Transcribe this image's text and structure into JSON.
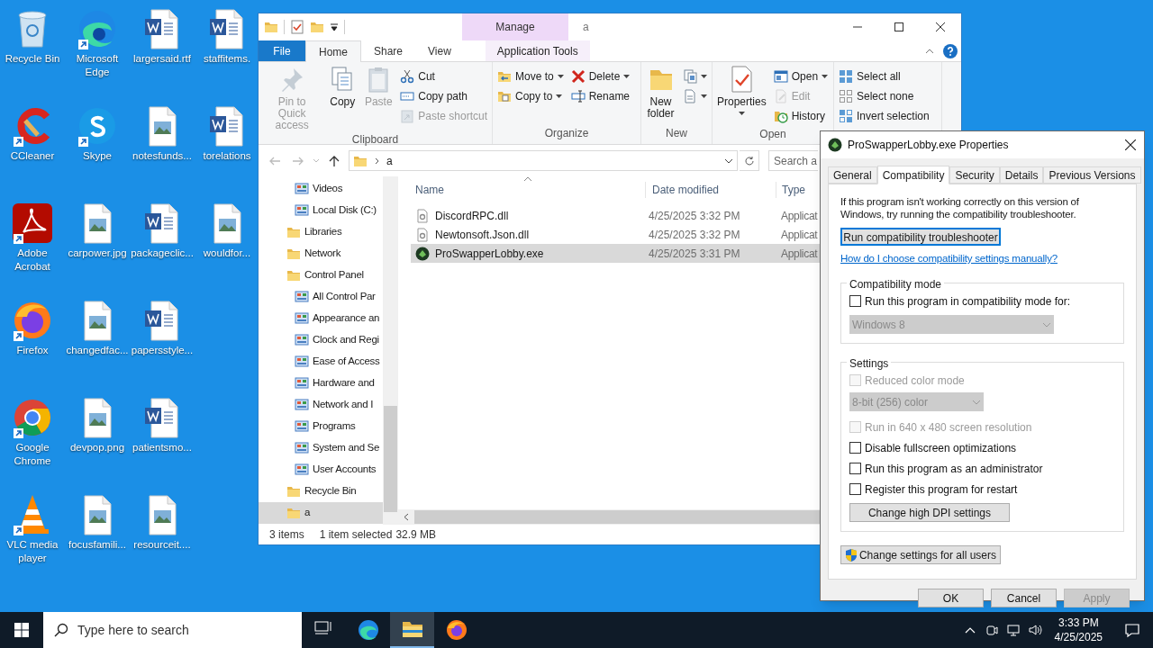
{
  "desktop": {
    "icons": [
      {
        "label": "Recycle Bin",
        "kind": "recycle",
        "shortcut": false
      },
      {
        "label": "CCleaner",
        "kind": "ccleaner",
        "shortcut": true
      },
      {
        "label": "Adobe Acrobat",
        "kind": "acrobat",
        "shortcut": true
      },
      {
        "label": "Firefox",
        "kind": "firefox",
        "shortcut": true
      },
      {
        "label": "Google Chrome",
        "kind": "chrome",
        "shortcut": true
      },
      {
        "label": "VLC media player",
        "kind": "vlc",
        "shortcut": true
      },
      {
        "label": "Microsoft Edge",
        "kind": "edge",
        "shortcut": true
      },
      {
        "label": "Skype",
        "kind": "skype",
        "shortcut": true
      },
      {
        "label": "carpower.jpg",
        "kind": "image",
        "shortcut": false
      },
      {
        "label": "changedfac...",
        "kind": "image",
        "shortcut": false
      },
      {
        "label": "devpop.png",
        "kind": "image",
        "shortcut": false
      },
      {
        "label": "focusfamili...",
        "kind": "image",
        "shortcut": false
      },
      {
        "label": "largersaid.rtf",
        "kind": "word",
        "shortcut": false
      },
      {
        "label": "notesfunds...",
        "kind": "image",
        "shortcut": false
      },
      {
        "label": "packageclic...",
        "kind": "word",
        "shortcut": false
      },
      {
        "label": "papersstyle...",
        "kind": "word",
        "shortcut": false
      },
      {
        "label": "patientsmo...",
        "kind": "word",
        "shortcut": false
      },
      {
        "label": "resourceit....",
        "kind": "image",
        "shortcut": false
      },
      {
        "label": "staffitems.",
        "kind": "word",
        "shortcut": false
      },
      {
        "label": "torelations",
        "kind": "word",
        "shortcut": false
      },
      {
        "label": "wouldfor...",
        "kind": "image",
        "shortcut": false
      }
    ]
  },
  "explorer": {
    "title": "a",
    "context_tab": "Manage",
    "tabs": [
      {
        "label": "File",
        "kind": "file",
        "selected": false
      },
      {
        "label": "Home",
        "kind": "tab",
        "selected": true
      },
      {
        "label": "Share",
        "kind": "tab",
        "selected": false
      },
      {
        "label": "View",
        "kind": "tab",
        "selected": false
      },
      {
        "label": "Application Tools",
        "kind": "context",
        "selected": false
      }
    ],
    "ribbon": [
      {
        "label": "Clipboard",
        "columns": [
          [
            {
              "label": "Pin to Quick access",
              "kind": "large",
              "disabled": true,
              "dropdown": false
            }
          ],
          [
            {
              "label": "Copy",
              "kind": "large",
              "disabled": false,
              "dropdown": false
            }
          ],
          [
            {
              "label": "Paste",
              "kind": "large",
              "disabled": true,
              "dropdown": false
            }
          ],
          [
            {
              "label": "Cut",
              "kind": "small",
              "disabled": false,
              "dropdown": false
            },
            {
              "label": "Copy path",
              "kind": "small",
              "disabled": false,
              "dropdown": false
            },
            {
              "label": "Paste shortcut",
              "kind": "small",
              "disabled": true,
              "dropdown": false
            }
          ]
        ]
      },
      {
        "label": "Organize",
        "columns": [
          [
            {
              "label": "Move to",
              "kind": "small",
              "disabled": false,
              "dropdown": true
            },
            {
              "label": "Copy to",
              "kind": "small",
              "disabled": false,
              "dropdown": true
            }
          ],
          [
            {
              "label": "Delete",
              "kind": "small",
              "disabled": false,
              "dropdown": true
            },
            {
              "label": "Rename",
              "kind": "small",
              "disabled": false,
              "dropdown": false
            }
          ]
        ]
      },
      {
        "label": "New",
        "columns": [
          [
            {
              "label": "New folder",
              "kind": "large",
              "disabled": false,
              "dropdown": false
            }
          ],
          [
            {
              "kind": "icon",
              "disabled": false,
              "dropdown": true
            },
            {
              "kind": "icon",
              "disabled": false,
              "dropdown": true
            }
          ]
        ]
      },
      {
        "label": "Open",
        "columns": [
          [
            {
              "label": "Properties",
              "kind": "large",
              "disabled": false,
              "dropdown": true
            }
          ],
          [
            {
              "label": "Open",
              "kind": "small",
              "disabled": false,
              "dropdown": true
            },
            {
              "label": "Edit",
              "kind": "small",
              "disabled": true,
              "dropdown": false
            },
            {
              "label": "History",
              "kind": "small",
              "disabled": false,
              "dropdown": false
            }
          ]
        ]
      },
      {
        "columns": [
          [
            {
              "label": "Select all",
              "kind": "small",
              "disabled": false,
              "dropdown": false
            },
            {
              "label": "Select none",
              "kind": "small",
              "disabled": false,
              "dropdown": false
            },
            {
              "label": "Invert selection",
              "kind": "small",
              "disabled": false,
              "dropdown": false
            }
          ]
        ]
      }
    ],
    "address": {
      "path": "a"
    },
    "search": {
      "placeholder": "Search a"
    },
    "nav": {
      "continued_items": [
        {
          "label": "Videos",
          "selected": false
        },
        {
          "label": "Local Disk (C:)",
          "selected": false
        }
      ],
      "items": [
        {
          "label": "Libraries",
          "selected": false
        },
        {
          "label": "Network",
          "selected": false
        },
        {
          "label": "Control Panel",
          "selected": false,
          "children": [
            {
              "label": "All Control Par",
              "selected": false
            },
            {
              "label": "Appearance an",
              "selected": false
            },
            {
              "label": "Clock and Regi",
              "selected": false
            },
            {
              "label": "Ease of Access",
              "selected": false
            },
            {
              "label": "Hardware and",
              "selected": false
            },
            {
              "label": "Network and I",
              "selected": false
            },
            {
              "label": "Programs",
              "selected": false
            },
            {
              "label": "System and Se",
              "selected": false
            },
            {
              "label": "User Accounts",
              "selected": false
            }
          ]
        },
        {
          "label": "Recycle Bin",
          "selected": false
        },
        {
          "label": "a",
          "selected": true
        }
      ]
    },
    "columns": [
      "Name",
      "Date modified",
      "Type"
    ],
    "files": [
      {
        "name": "DiscordRPC.dll",
        "date": "4/25/2025 3:32 PM",
        "type": "Applicat",
        "kind": "dll",
        "selected": false
      },
      {
        "name": "Newtonsoft.Json.dll",
        "date": "4/25/2025 3:32 PM",
        "type": "Applicat",
        "kind": "dll",
        "selected": false
      },
      {
        "name": "ProSwapperLobby.exe",
        "date": "4/25/2025 3:31 PM",
        "type": "Applicat",
        "kind": "exe",
        "selected": true
      }
    ],
    "status": {
      "count": "3 items",
      "selection": "1 item selected",
      "size": "32.9 MB"
    }
  },
  "dialog": {
    "title": "ProSwapperLobby.exe Properties",
    "tabs": [
      {
        "label": "General",
        "selected": false
      },
      {
        "label": "Compatibility",
        "selected": true
      },
      {
        "label": "Security",
        "selected": false
      },
      {
        "label": "Details",
        "selected": false
      },
      {
        "label": "Previous Versions",
        "selected": false
      }
    ],
    "intro": "If this program isn't working correctly on this version of Windows, try running the compatibility troubleshooter.",
    "troubleshooter_button": "Run compatibility troubleshooter",
    "help_link": "How do I choose compatibility settings manually?",
    "compatibility_mode": {
      "legend": "Compatibility mode",
      "option": {
        "label": "Run this program in compatibility mode for:",
        "checked": false,
        "disabled": false
      },
      "os_select": {
        "value": "Windows 8",
        "disabled": true
      }
    },
    "settings": {
      "legend": "Settings",
      "options": [
        {
          "kind": "checkbox",
          "label": "Reduced color mode",
          "checked": false,
          "disabled": true
        },
        {
          "kind": "select",
          "value": "8-bit (256) color",
          "disabled": true
        },
        {
          "kind": "checkbox",
          "label": "Run in 640 x 480 screen resolution",
          "checked": false,
          "disabled": true
        },
        {
          "kind": "checkbox",
          "label": "Disable fullscreen optimizations",
          "checked": false,
          "disabled": false
        },
        {
          "kind": "checkbox",
          "label": "Run this program as an administrator",
          "checked": false,
          "disabled": false
        },
        {
          "kind": "checkbox",
          "label": "Register this program for restart",
          "checked": false,
          "disabled": false
        },
        {
          "kind": "button",
          "label": "Change high DPI settings"
        }
      ]
    },
    "all_users_button": "Change settings for all users",
    "buttons": [
      {
        "label": "OK",
        "disabled": false
      },
      {
        "label": "Cancel",
        "disabled": false
      },
      {
        "label": "Apply",
        "disabled": true
      }
    ]
  },
  "taskbar": {
    "search_placeholder": "Type here to search",
    "apps": [
      {
        "kind": "taskview",
        "active": false
      },
      {
        "kind": "edge",
        "active": false
      },
      {
        "kind": "explorer",
        "active": true
      },
      {
        "kind": "firefox",
        "active": false
      }
    ],
    "time": "3:33 PM",
    "date": "4/25/2025"
  }
}
